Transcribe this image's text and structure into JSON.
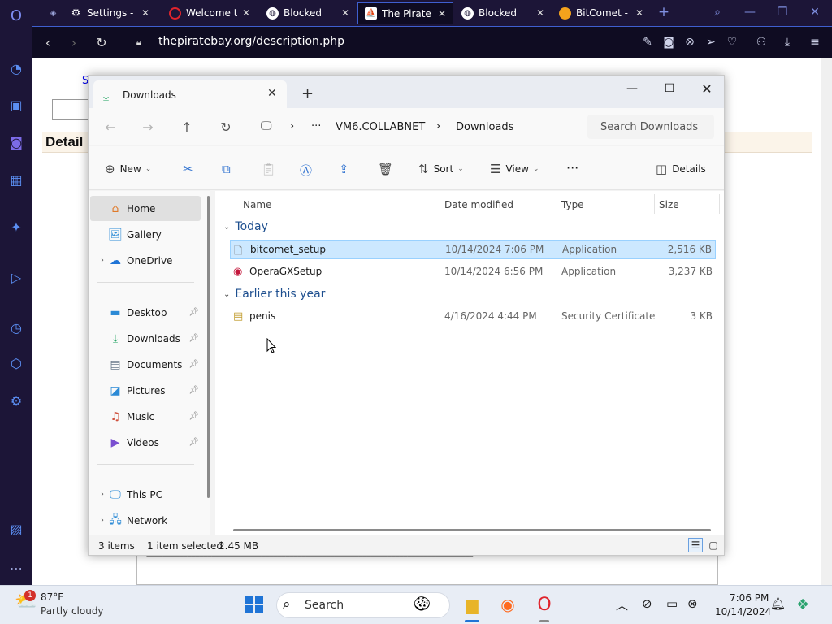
{
  "browser": {
    "tabs": [
      {
        "label": "Settings - Pr",
        "icon": "gear-icon"
      },
      {
        "label": "Welcome to",
        "icon": "opera-icon"
      },
      {
        "label": "Blocked",
        "icon": "globe-icon"
      },
      {
        "label": "The Pirate B",
        "icon": "pirate-ship-icon"
      },
      {
        "label": "Blocked",
        "icon": "globe-icon"
      },
      {
        "label": "BitComet - D",
        "icon": "bitcomet-icon"
      }
    ],
    "url": "thepiratebay.org/description.php"
  },
  "web": {
    "link_text": "S",
    "heading": "Detail",
    "nfo_line": "================================================================================"
  },
  "explorer": {
    "tab_title": "Downloads",
    "breadcrumb": {
      "more": "···",
      "root": "VM6.COLLABNET",
      "current": "Downloads"
    },
    "search_placeholder": "Search Downloads",
    "commands": {
      "new": "New",
      "sort": "Sort",
      "view": "View",
      "more": "···",
      "details": "Details"
    },
    "nav": {
      "home": "Home",
      "gallery": "Gallery",
      "onedrive": "OneDrive",
      "desktop": "Desktop",
      "downloads": "Downloads",
      "documents": "Documents",
      "pictures": "Pictures",
      "music": "Music",
      "videos": "Videos",
      "thispc": "This PC",
      "network": "Network"
    },
    "columns": {
      "name": "Name",
      "date": "Date modified",
      "type": "Type",
      "size": "Size"
    },
    "groups": {
      "today": "Today",
      "earlier": "Earlier this year"
    },
    "files": [
      {
        "name": "bitcomet_setup",
        "date": "10/14/2024 7:06 PM",
        "type": "Application",
        "size": "2,516 KB",
        "icon": "blank-file-icon"
      },
      {
        "name": "OperaGXSetup",
        "date": "10/14/2024 6:56 PM",
        "type": "Application",
        "size": "3,237 KB",
        "icon": "opera-gx-icon"
      },
      {
        "name": "penis",
        "date": "4/16/2024 4:44 PM",
        "type": "Security Certificate",
        "size": "3 KB",
        "icon": "certificate-icon"
      }
    ],
    "status": {
      "items": "3 items",
      "selected": "1 item selected",
      "size": "2.45 MB"
    }
  },
  "taskbar": {
    "weather_temp": "87°F",
    "weather_desc": "Partly cloudy",
    "weather_badge": "1",
    "search_label": "Search",
    "time": "7:06 PM",
    "date": "10/14/2024"
  },
  "colors": {
    "accent": "#1f74d6",
    "opera_sidebar": "#1c1537",
    "selection": "#cce8ff"
  }
}
